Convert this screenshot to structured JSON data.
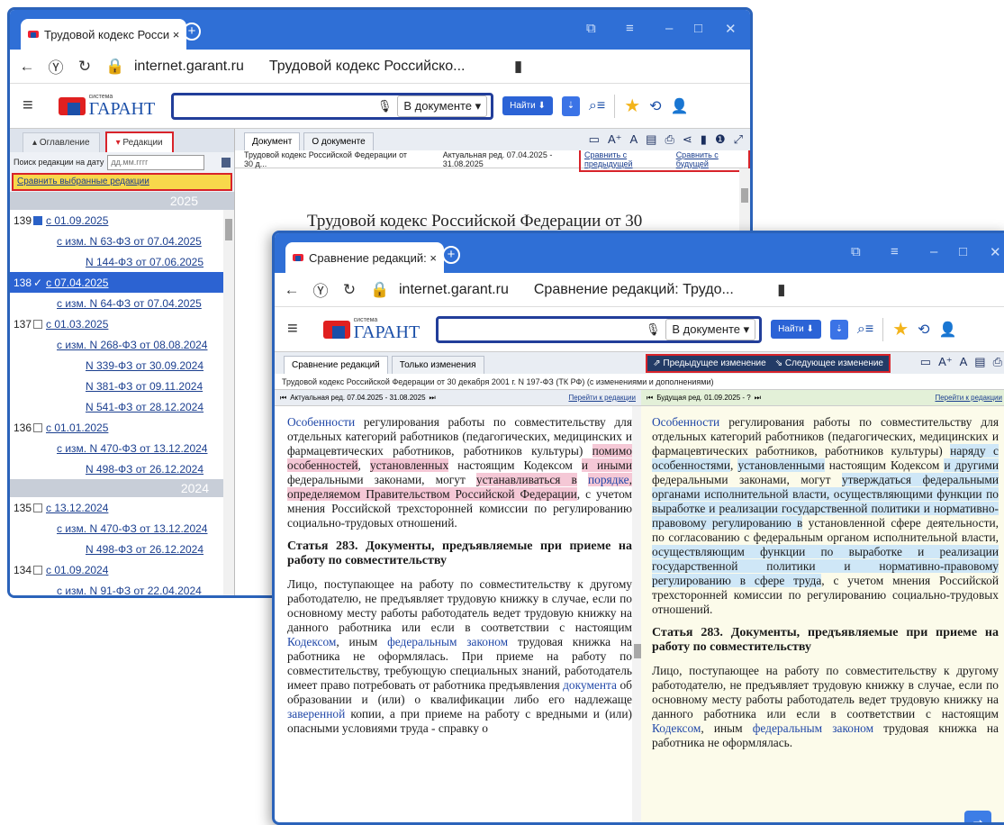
{
  "back_window": {
    "tab_title": "Трудовой кодекс Росси ×",
    "url_host": "internet.garant.ru",
    "page_title": "Трудовой кодекс Российско...",
    "logo_small": "система",
    "logo_big": "ГАРАНТ",
    "search_scope": "В документе",
    "find_label": "Найти",
    "panel_tabs": [
      "Оглавление",
      "Редакции"
    ],
    "search_date_label": "Поиск редакции на дату",
    "search_date_placeholder": "дд.мм.гггг",
    "compare_selected": "Сравнить выбранные редакции",
    "years": [
      "2025",
      "2024"
    ],
    "revisions": [
      {
        "num": "139",
        "date": "с 01.09.2025",
        "checked": true
      },
      {
        "sub": "с изм. N 63-ФЗ от 07.04.2025"
      },
      {
        "sub2": "N 144-ФЗ от 07.06.2025"
      },
      {
        "num": "138",
        "date": "с 07.04.2025",
        "checked": true,
        "active": true
      },
      {
        "sub": "с изм. N 64-ФЗ от 07.04.2025"
      },
      {
        "num": "137",
        "date": "с 01.03.2025"
      },
      {
        "sub": "с изм. N 268-ФЗ от 08.08.2024"
      },
      {
        "sub2": "N 339-ФЗ от 30.09.2024"
      },
      {
        "sub2": "N 381-ФЗ от 09.11.2024"
      },
      {
        "sub2": "N 541-ФЗ от 28.12.2024"
      },
      {
        "num": "136",
        "date": "с 01.01.2025"
      },
      {
        "sub": "с изм. N 470-ФЗ от 13.12.2024"
      },
      {
        "sub2": "N 498-ФЗ от 26.12.2024"
      },
      {
        "num": "135",
        "date": "с 13.12.2024"
      },
      {
        "sub": "с изм. N 470-ФЗ от 13.12.2024"
      },
      {
        "sub2": "N 498-ФЗ от 26.12.2024"
      },
      {
        "num": "134",
        "date": "с 01.09.2024"
      },
      {
        "sub": "с изм. N 91-ФЗ от 22.04.2024"
      }
    ],
    "doc_tabs": [
      "Документ",
      "О документе"
    ],
    "doc_name": "Трудовой кодекс Российской Федерации от 30 д...",
    "actual_red": "Актуальная ред. 07.04.2025 - 31.08.2025",
    "cmp_prev": "Сравнить с предыдущей",
    "cmp_next": "Сравнить с будущей",
    "doc_heading": "Трудовой кодекс Российской Федерации от 30"
  },
  "front_window": {
    "tab_title": "Сравнение редакций: ×",
    "url_host": "internet.garant.ru",
    "page_title": "Сравнение редакций: Трудо...",
    "search_scope": "В документе",
    "find_label": "Найти",
    "tabs": [
      "Сравнение редакций",
      "Только изменения"
    ],
    "prev_change": "Предыдущее изменение",
    "next_change": "Следующее изменение",
    "doc_line": "Трудовой кодекс Российской Федерации от 30 декабря 2001 г. N 197-ФЗ (ТК РФ) (с изменениями и дополнениями)",
    "left_head": "Актуальная ред. 07.04.2025 - 31.08.2025",
    "right_head": "Будущая ред. 01.09.2025 - ?",
    "go_red": "Перейти к редакции",
    "article_title": "Статья 283. Документы, предъявляемые при приеме на работу по совместительству"
  }
}
